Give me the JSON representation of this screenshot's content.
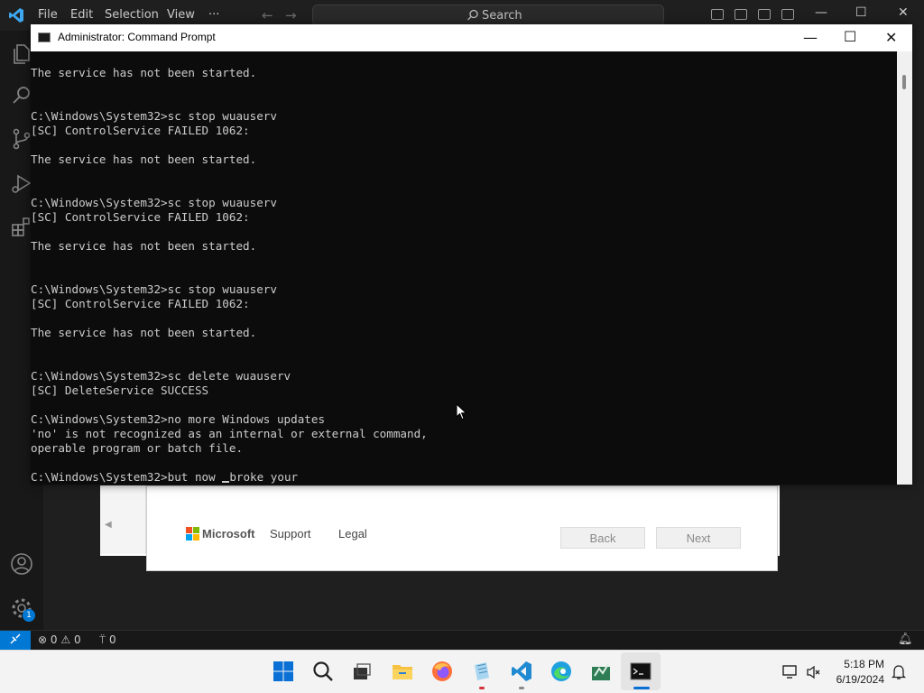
{
  "vscode": {
    "menu": [
      "File",
      "Edit",
      "Selection",
      "View",
      "···"
    ],
    "search_label": "Search",
    "status": {
      "errors": "0",
      "warnings": "0",
      "ports": "0"
    },
    "accounts_badge": "1"
  },
  "installer": {
    "brand": "Microsoft",
    "links": [
      "Support",
      "Legal"
    ],
    "back_label": "Back",
    "next_label": "Next"
  },
  "cmd": {
    "title": "Administrator: Command Prompt",
    "output_lines": [
      "The service has not been started.",
      "",
      "",
      "C:\\Windows\\System32>sc stop wuauserv",
      "[SC] ControlService FAILED 1062:",
      "",
      "The service has not been started.",
      "",
      "",
      "C:\\Windows\\System32>sc stop wuauserv",
      "[SC] ControlService FAILED 1062:",
      "",
      "The service has not been started.",
      "",
      "",
      "C:\\Windows\\System32>sc stop wuauserv",
      "[SC] ControlService FAILED 1062:",
      "",
      "The service has not been started.",
      "",
      "",
      "C:\\Windows\\System32>sc delete wuauserv",
      "[SC] DeleteService SUCCESS",
      "",
      "C:\\Windows\\System32>no more Windows updates",
      "'no' is not recognized as an internal or external command,",
      "operable program or batch file.",
      ""
    ],
    "input_line_before_cursor": "C:\\Windows\\System32>but now ",
    "input_line_after_cursor": "broke your"
  },
  "taskbar": {
    "apps": [
      "start-icon",
      "search-icon",
      "task-view-icon",
      "file-explorer-icon",
      "firefox-icon",
      "notepad-icon",
      "vscode-icon",
      "edge-icon",
      "app-icon",
      "terminal-icon"
    ],
    "time": "5:18 PM",
    "date": "6/19/2024"
  },
  "colors": {
    "vscode_accent": "#0078d4",
    "cmd_background": "#0c0c0c",
    "cmd_text": "#cccccc"
  }
}
